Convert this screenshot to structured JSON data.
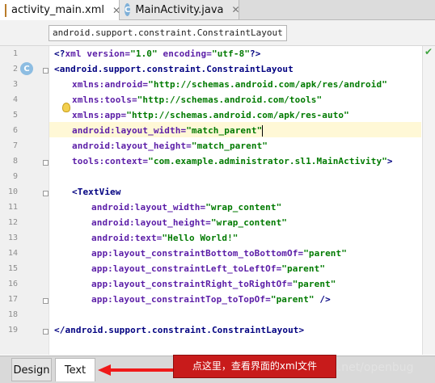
{
  "tabs": [
    {
      "label": "activity_main.xml",
      "icon": "xml-file-icon",
      "active": true
    },
    {
      "label": "MainActivity.java",
      "icon": "java-class-icon",
      "active": false
    }
  ],
  "breadcrumb": "android.support.constraint.ConstraintLayout",
  "line_numbers": [
    "1",
    "2",
    "3",
    "4",
    "5",
    "6",
    "7",
    "8",
    "9",
    "10",
    "11",
    "12",
    "13",
    "14",
    "15",
    "16",
    "17",
    "18",
    "19"
  ],
  "code": {
    "l1": {
      "a": "<?",
      "b": "xml version=",
      "c": "\"1.0\"",
      "d": " encoding=",
      "e": "\"utf-8\"",
      "f": "?>"
    },
    "l2": {
      "a": "<android.support.constraint.ConstraintLayout"
    },
    "l3": {
      "a": "xmlns:android=",
      "b": "\"http://schemas.android.com/apk/res/android\""
    },
    "l4": {
      "a": "xmlns:tools=",
      "b": "\"http://schemas.android.com/tools\""
    },
    "l5": {
      "a": "xmlns:app=",
      "b": "\"http://schemas.android.com/apk/res-auto\""
    },
    "l6": {
      "a": "android:layout_width=",
      "b": "\"match_parent\""
    },
    "l7": {
      "a": "android:layout_height=",
      "b": "\"match_parent\""
    },
    "l8": {
      "a": "tools:context=",
      "b": "\"com.example.administrator.sl1.MainActivity\"",
      "c": ">"
    },
    "l10": {
      "a": "<TextView"
    },
    "l11": {
      "a": "android:layout_width=",
      "b": "\"wrap_content\""
    },
    "l12": {
      "a": "android:layout_height=",
      "b": "\"wrap_content\""
    },
    "l13": {
      "a": "android:text=",
      "b": "\"Hello World!\""
    },
    "l14": {
      "a": "app:layout_constraintBottom_toBottomOf=",
      "b": "\"parent\""
    },
    "l15": {
      "a": "app:layout_constraintLeft_toLeftOf=",
      "b": "\"parent\""
    },
    "l16": {
      "a": "app:layout_constraintRight_toRightOf=",
      "b": "\"parent\""
    },
    "l17": {
      "a": "app:layout_constraintTop_toTopOf=",
      "b": "\"parent\"",
      "c": " />"
    },
    "l19": {
      "a": "</android.support.constraint.ConstraintLayout>"
    }
  },
  "gutter": {
    "class_badge": "C"
  },
  "bottom_tabs": {
    "design": "Design",
    "text": "Text"
  },
  "annotation": "点这里，查看界面的xml文件",
  "watermark": "dn.net/openbug",
  "colors": {
    "tag": "#000080",
    "attribute": "#5b1da7",
    "value": "#007a00",
    "annotation_bg": "#c81b1b",
    "arrow": "#ef1a1a"
  }
}
